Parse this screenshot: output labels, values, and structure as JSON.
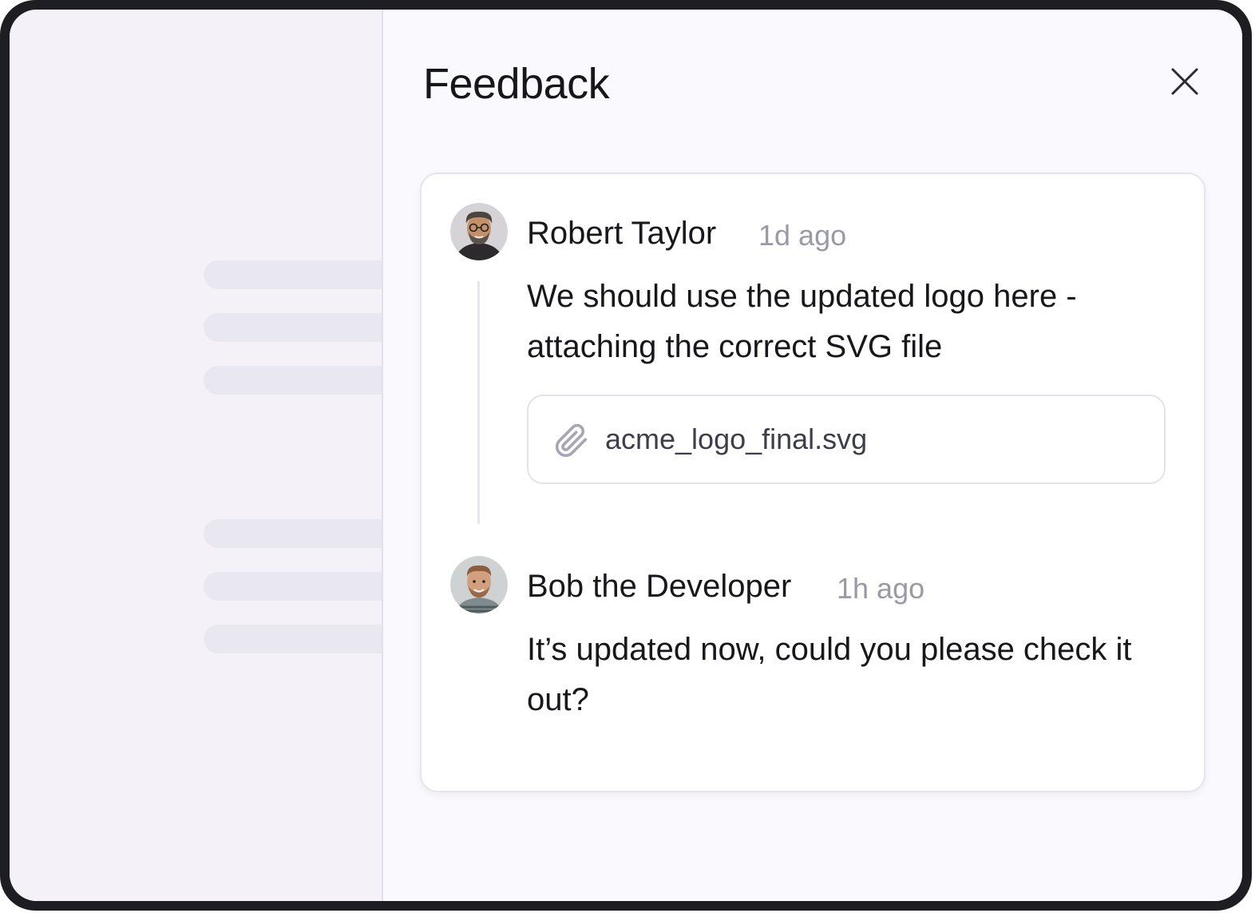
{
  "panel": {
    "title": "Feedback",
    "close_icon": "close-icon"
  },
  "comments": [
    {
      "author": "Robert Taylor",
      "time": "1d ago",
      "text": "We should use the updated logo here - attaching the correct SVG file",
      "attachment": {
        "icon": "paperclip-icon",
        "filename": "acme_logo_final.svg"
      }
    },
    {
      "author": "Bob the Developer",
      "time": "1h ago",
      "text": "It’s updated now, could you please check it out?"
    }
  ],
  "colors": {
    "frame": "#1d1d22",
    "background": "#f4f2f8",
    "panel": "#faf9fd",
    "card": "#ffffff",
    "text": "#17171c",
    "muted": "#9a9aa6",
    "icon": "#a8a6b4"
  }
}
